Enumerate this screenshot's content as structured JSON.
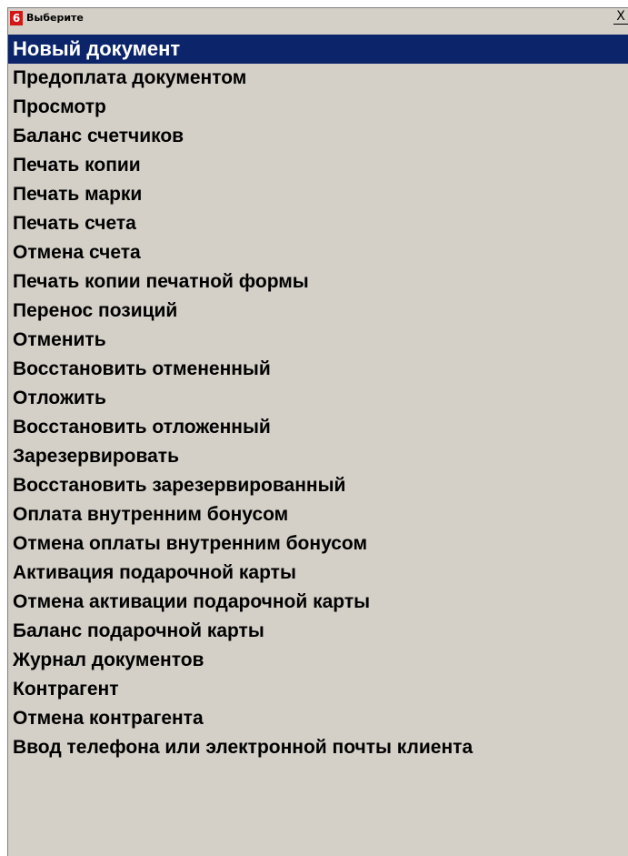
{
  "window": {
    "title": "Выберите",
    "icon_label": "6",
    "icon_color": "#d01818",
    "close_label": "X"
  },
  "colors": {
    "background": "#d4d0c8",
    "selected_bg": "#0b246a",
    "selected_text": "#ffffff",
    "text": "#000000"
  },
  "menu": {
    "selected_index": 0,
    "items": [
      {
        "label": "Новый документ"
      },
      {
        "label": "Предоплата документом"
      },
      {
        "label": "Просмотр"
      },
      {
        "label": "Баланс счетчиков"
      },
      {
        "label": "Печать копии"
      },
      {
        "label": "Печать марки"
      },
      {
        "label": "Печать счета"
      },
      {
        "label": "Отмена счета"
      },
      {
        "label": "Печать копии печатной формы"
      },
      {
        "label": "Перенос позиций"
      },
      {
        "label": "Отменить"
      },
      {
        "label": "Восстановить отмененный"
      },
      {
        "label": "Отложить"
      },
      {
        "label": "Восстановить отложенный"
      },
      {
        "label": "Зарезервировать"
      },
      {
        "label": "Восстановить зарезервированный"
      },
      {
        "label": "Оплата внутренним бонусом"
      },
      {
        "label": "Отмена оплаты внутренним бонусом"
      },
      {
        "label": "Активация подарочной карты"
      },
      {
        "label": "Отмена активации подарочной карты"
      },
      {
        "label": "Баланс подарочной карты"
      },
      {
        "label": "Журнал документов"
      },
      {
        "label": "Контрагент"
      },
      {
        "label": "Отмена контрагента"
      },
      {
        "label": "Ввод телефона или электронной почты клиента"
      }
    ]
  }
}
